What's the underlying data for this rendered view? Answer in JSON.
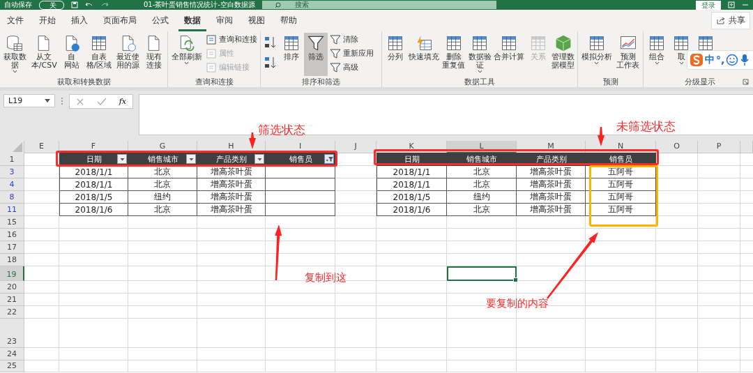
{
  "title_bar": {
    "autosave_label": "自动保存",
    "autosave_state": "关",
    "autosave_on": false,
    "title": "01-茶叶蛋销售情况统计-空白数据源",
    "search_placeholder": "搜索",
    "login": "登录"
  },
  "ribbon_tabs": [
    {
      "label": "文件",
      "selected": false
    },
    {
      "label": "开始",
      "selected": false
    },
    {
      "label": "插入",
      "selected": false
    },
    {
      "label": "页面布局",
      "selected": false
    },
    {
      "label": "公式",
      "selected": false
    },
    {
      "label": "数据",
      "selected": true
    },
    {
      "label": "审阅",
      "selected": false
    },
    {
      "label": "视图",
      "selected": false
    },
    {
      "label": "帮助",
      "selected": false
    }
  ],
  "share_button": "共享",
  "ribbon_groups": [
    {
      "label": "获取和转换数据",
      "commands": [
        {
          "kind": "large",
          "lines": [
            "获取数",
            "据"
          ],
          "dropdown": true,
          "disabled": false,
          "pressed": false
        },
        {
          "kind": "large",
          "lines": [
            "从文",
            "本/CSV"
          ],
          "dropdown": false,
          "disabled": false,
          "pressed": false
        },
        {
          "kind": "large",
          "lines": [
            "自",
            "网站"
          ],
          "dropdown": false,
          "disabled": false,
          "pressed": false
        },
        {
          "kind": "large",
          "lines": [
            "自表",
            "格/区域"
          ],
          "dropdown": false,
          "disabled": false,
          "pressed": false
        },
        {
          "kind": "large",
          "lines": [
            "最近使",
            "用的源"
          ],
          "dropdown": false,
          "disabled": false,
          "pressed": false
        },
        {
          "kind": "large",
          "lines": [
            "现有",
            "连接"
          ],
          "dropdown": false,
          "disabled": false,
          "pressed": false
        }
      ]
    },
    {
      "label": "查询和连接",
      "commands": [
        {
          "kind": "large",
          "lines": [
            "全部刷新"
          ],
          "dropdown": true,
          "disabled": false,
          "pressed": false
        },
        {
          "kind": "small",
          "lines": [
            "查询和连接"
          ],
          "disabled": false,
          "pressed": false
        },
        {
          "kind": "small",
          "lines": [
            "属性"
          ],
          "disabled": true,
          "pressed": false
        },
        {
          "kind": "small",
          "lines": [
            "编辑链接"
          ],
          "disabled": true,
          "pressed": false
        }
      ]
    },
    {
      "label": "排序和筛选",
      "commands": [
        {
          "kind": "sort",
          "disabled": false,
          "pressed": false
        },
        {
          "kind": "sort",
          "disabled": false,
          "pressed": false
        },
        {
          "kind": "large",
          "lines": [
            "排序"
          ],
          "dropdown": false,
          "disabled": false,
          "pressed": false
        },
        {
          "kind": "large",
          "lines": [
            "筛选"
          ],
          "dropdown": false,
          "disabled": false,
          "pressed": true
        },
        {
          "kind": "small",
          "lines": [
            "清除"
          ],
          "disabled": false,
          "pressed": false
        },
        {
          "kind": "small",
          "lines": [
            "重新应用"
          ],
          "disabled": false,
          "pressed": false
        },
        {
          "kind": "small",
          "lines": [
            "高级"
          ],
          "disabled": false,
          "pressed": false
        }
      ]
    },
    {
      "label": "数据工具",
      "commands": [
        {
          "kind": "large",
          "lines": [
            "分列"
          ],
          "dropdown": false,
          "disabled": false,
          "pressed": false
        },
        {
          "kind": "large",
          "lines": [
            "快速填充"
          ],
          "dropdown": false,
          "disabled": false,
          "pressed": false
        },
        {
          "kind": "large",
          "lines": [
            "删除",
            "重复值"
          ],
          "dropdown": false,
          "disabled": false,
          "pressed": false
        },
        {
          "kind": "large",
          "lines": [
            "数据验",
            "证"
          ],
          "dropdown": true,
          "disabled": false,
          "pressed": false
        },
        {
          "kind": "large",
          "lines": [
            "合并计算"
          ],
          "dropdown": false,
          "disabled": false,
          "pressed": false
        },
        {
          "kind": "large",
          "lines": [
            "关系"
          ],
          "dropdown": false,
          "disabled": true,
          "pressed": false
        },
        {
          "kind": "large",
          "lines": [
            "管理数",
            "据模型"
          ],
          "dropdown": false,
          "disabled": false,
          "pressed": false
        }
      ]
    },
    {
      "label": "预测",
      "commands": [
        {
          "kind": "large",
          "lines": [
            "模拟分析"
          ],
          "dropdown": true,
          "disabled": false,
          "pressed": false
        },
        {
          "kind": "large",
          "lines": [
            "预测",
            "工作表"
          ],
          "dropdown": false,
          "disabled": false,
          "pressed": false
        }
      ]
    },
    {
      "label": "分级显示",
      "commands": [
        {
          "kind": "large",
          "lines": [
            "组合"
          ],
          "dropdown": true,
          "disabled": false,
          "pressed": false
        },
        {
          "kind": "large",
          "lines": [
            "取"
          ],
          "dropdown": true,
          "disabled": false,
          "pressed": false
        },
        {
          "kind": "large",
          "disabled": false,
          "pressed": false
        }
      ]
    }
  ],
  "ime_toolbar": {
    "mode": "中",
    "punctuation": "°,"
  },
  "formula_bar": {
    "name_box": "L19",
    "function_label": "fx"
  },
  "sheet": {
    "columns": [
      {
        "letter": "E",
        "selected": false
      },
      {
        "letter": "F",
        "selected": false
      },
      {
        "letter": "G",
        "selected": false
      },
      {
        "letter": "H",
        "selected": false
      },
      {
        "letter": "I",
        "selected": false
      },
      {
        "letter": "J",
        "selected": false
      },
      {
        "letter": "K",
        "selected": false
      },
      {
        "letter": "L",
        "selected": true
      },
      {
        "letter": "M",
        "selected": false
      },
      {
        "letter": "N",
        "selected": false
      },
      {
        "letter": "O",
        "selected": false
      },
      {
        "letter": "P",
        "selected": false
      }
    ],
    "rows": [
      {
        "number": "1",
        "filter_match": false,
        "selected": false
      },
      {
        "number": "3",
        "filter_match": true,
        "selected": false
      },
      {
        "number": "4",
        "filter_match": true,
        "selected": false
      },
      {
        "number": "8",
        "filter_match": true,
        "selected": false
      },
      {
        "number": "11",
        "filter_match": true,
        "selected": false
      },
      {
        "number": "15",
        "filter_match": false,
        "selected": false
      },
      {
        "number": "16",
        "filter_match": false,
        "selected": false
      },
      {
        "number": "17",
        "filter_match": false,
        "selected": false
      },
      {
        "number": "18",
        "filter_match": false,
        "selected": false
      },
      {
        "number": "19",
        "filter_match": false,
        "selected": true
      },
      {
        "number": "20",
        "filter_match": false,
        "selected": false
      },
      {
        "number": "21",
        "filter_match": false,
        "selected": false
      },
      {
        "number": "22",
        "filter_match": false,
        "selected": false
      },
      {
        "number": "23",
        "filter_match": false,
        "selected": false
      },
      {
        "number": "24",
        "filter_match": false,
        "selected": false
      },
      {
        "number": "25",
        "filter_match": false,
        "selected": false
      }
    ],
    "tables": [
      {
        "headers": [
          {
            "label": "日期",
            "filter_button": true,
            "filtered": false
          },
          {
            "label": "销售城市",
            "filter_button": true,
            "filtered": false
          },
          {
            "label": "产品类别",
            "filter_button": true,
            "filtered": false
          },
          {
            "label": "销售员",
            "filter_button": true,
            "filtered": true
          }
        ],
        "rows": [
          {
            "cells": [
              "2018/1/1",
              "北京",
              "增高茶叶蛋"
            ]
          },
          {
            "cells": [
              "2018/1/1",
              "北京",
              "增高茶叶蛋"
            ]
          },
          {
            "cells": [
              "2018/1/5",
              "纽约",
              "增高茶叶蛋"
            ]
          },
          {
            "cells": [
              "2018/1/6",
              "北京",
              "增高茶叶蛋"
            ]
          }
        ]
      },
      {
        "headers": [
          {
            "label": "日期",
            "filter_button": false
          },
          {
            "label": "销售城市",
            "filter_button": false
          },
          {
            "label": "产品类别",
            "filter_button": false
          },
          {
            "label": "销售员",
            "filter_button": false
          }
        ],
        "rows": [
          {
            "cells": [
              "2018/1/1",
              "北京",
              "增高茶叶蛋",
              "五阿哥"
            ]
          },
          {
            "cells": [
              "2018/1/1",
              "北京",
              "增高茶叶蛋",
              "五阿哥"
            ]
          },
          {
            "cells": [
              "2018/1/5",
              "纽约",
              "增高茶叶蛋",
              "五阿哥"
            ]
          },
          {
            "cells": [
              "2018/1/6",
              "北京",
              "增高茶叶蛋",
              "五阿哥"
            ]
          }
        ]
      }
    ]
  },
  "annotations": [
    {
      "kind": "label",
      "text": "筛选状态"
    },
    {
      "kind": "label",
      "text": "未筛选状态"
    },
    {
      "kind": "label",
      "text": "复制到这"
    },
    {
      "kind": "label",
      "text": "要复制的内容"
    },
    {
      "kind": "box",
      "color": "#ff2a2a"
    },
    {
      "kind": "box",
      "color": "#ff2a2a"
    },
    {
      "kind": "box",
      "color": "#ffb400"
    },
    {
      "kind": "arrow"
    },
    {
      "kind": "arrow"
    },
    {
      "kind": "arrow"
    },
    {
      "kind": "arrow"
    }
  ]
}
